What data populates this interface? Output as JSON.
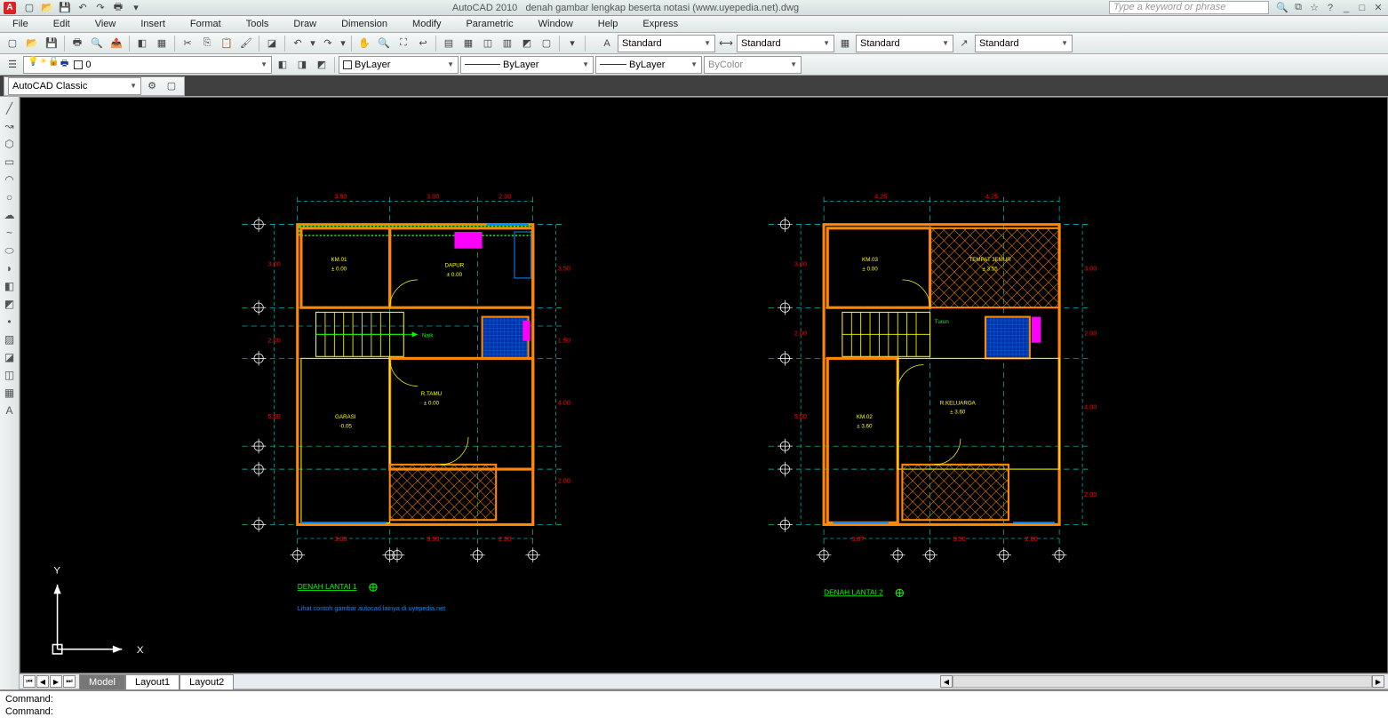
{
  "app": {
    "name": "AutoCAD 2010",
    "doc": "denah gambar lengkap beserta notasi (www.uyepedia.net).dwg",
    "search_placeholder": "Type a keyword or phrase"
  },
  "menus": [
    "File",
    "Edit",
    "View",
    "Insert",
    "Format",
    "Tools",
    "Draw",
    "Dimension",
    "Modify",
    "Parametric",
    "Window",
    "Help",
    "Express"
  ],
  "styles": {
    "text": "Standard",
    "dim": "Standard",
    "table": "Standard",
    "mleader": "Standard"
  },
  "layer": {
    "current": "0",
    "bylayer": "ByLayer",
    "bycolor": "ByColor"
  },
  "workspace": "AutoCAD Classic",
  "tabs": {
    "model": "Model",
    "l1": "Layout1",
    "l2": "Layout2"
  },
  "cmd1": "Command:",
  "cmd2": "Command:",
  "axes": {
    "x": "X",
    "y": "Y"
  },
  "plan1": {
    "title": "DENAH LANTAI 1",
    "note": "Lihat contoh gambar autocad lainya di uyepedia.net",
    "rooms": {
      "km01": "KM.01",
      "km01_lv": "± 0.00",
      "dapur": "DAPUR",
      "dapur_lv": "± 0.00",
      "rtamu": "R.TAMU",
      "rtamu_lv": "± 0.00",
      "garasi": "GARASI",
      "garasi_lv": "-0.05",
      "naik": "Naik"
    },
    "dims": {
      "d350": "3.50",
      "d300": "3.00",
      "d200": "2.00",
      "d150": "1.50",
      "d400": "4.00",
      "d500": "5.00"
    }
  },
  "plan2": {
    "title": "DENAH LANTAI 2",
    "rooms": {
      "km03": "KM.03",
      "km03_lv": "± 0.00",
      "jemur": "TEMPAT JEMUR",
      "jemur_lv": "± 3.55",
      "km02": "KM.02",
      "km02_lv": "± 3.60",
      "keluarga": "R.KELUARGA",
      "keluarga_lv": "± 3.60",
      "turun": "Turun"
    },
    "dims": {
      "d425": "4.25",
      "d300": "3.00",
      "d200": "2.00",
      "d387": "3.87",
      "d350": "3.50",
      "d400": "4.00",
      "d500": "5.00"
    }
  }
}
